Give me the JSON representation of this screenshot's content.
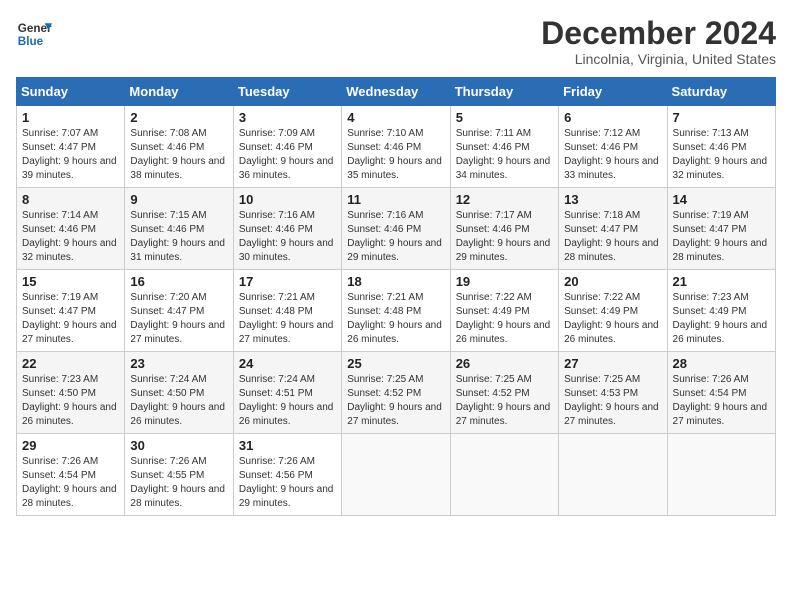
{
  "logo": {
    "line1": "General",
    "line2": "Blue"
  },
  "title": "December 2024",
  "subtitle": "Lincolnia, Virginia, United States",
  "days_of_week": [
    "Sunday",
    "Monday",
    "Tuesday",
    "Wednesday",
    "Thursday",
    "Friday",
    "Saturday"
  ],
  "weeks": [
    [
      {
        "day": "1",
        "sunrise": "Sunrise: 7:07 AM",
        "sunset": "Sunset: 4:47 PM",
        "daylight": "Daylight: 9 hours and 39 minutes."
      },
      {
        "day": "2",
        "sunrise": "Sunrise: 7:08 AM",
        "sunset": "Sunset: 4:46 PM",
        "daylight": "Daylight: 9 hours and 38 minutes."
      },
      {
        "day": "3",
        "sunrise": "Sunrise: 7:09 AM",
        "sunset": "Sunset: 4:46 PM",
        "daylight": "Daylight: 9 hours and 36 minutes."
      },
      {
        "day": "4",
        "sunrise": "Sunrise: 7:10 AM",
        "sunset": "Sunset: 4:46 PM",
        "daylight": "Daylight: 9 hours and 35 minutes."
      },
      {
        "day": "5",
        "sunrise": "Sunrise: 7:11 AM",
        "sunset": "Sunset: 4:46 PM",
        "daylight": "Daylight: 9 hours and 34 minutes."
      },
      {
        "day": "6",
        "sunrise": "Sunrise: 7:12 AM",
        "sunset": "Sunset: 4:46 PM",
        "daylight": "Daylight: 9 hours and 33 minutes."
      },
      {
        "day": "7",
        "sunrise": "Sunrise: 7:13 AM",
        "sunset": "Sunset: 4:46 PM",
        "daylight": "Daylight: 9 hours and 32 minutes."
      }
    ],
    [
      {
        "day": "8",
        "sunrise": "Sunrise: 7:14 AM",
        "sunset": "Sunset: 4:46 PM",
        "daylight": "Daylight: 9 hours and 32 minutes."
      },
      {
        "day": "9",
        "sunrise": "Sunrise: 7:15 AM",
        "sunset": "Sunset: 4:46 PM",
        "daylight": "Daylight: 9 hours and 31 minutes."
      },
      {
        "day": "10",
        "sunrise": "Sunrise: 7:16 AM",
        "sunset": "Sunset: 4:46 PM",
        "daylight": "Daylight: 9 hours and 30 minutes."
      },
      {
        "day": "11",
        "sunrise": "Sunrise: 7:16 AM",
        "sunset": "Sunset: 4:46 PM",
        "daylight": "Daylight: 9 hours and 29 minutes."
      },
      {
        "day": "12",
        "sunrise": "Sunrise: 7:17 AM",
        "sunset": "Sunset: 4:46 PM",
        "daylight": "Daylight: 9 hours and 29 minutes."
      },
      {
        "day": "13",
        "sunrise": "Sunrise: 7:18 AM",
        "sunset": "Sunset: 4:47 PM",
        "daylight": "Daylight: 9 hours and 28 minutes."
      },
      {
        "day": "14",
        "sunrise": "Sunrise: 7:19 AM",
        "sunset": "Sunset: 4:47 PM",
        "daylight": "Daylight: 9 hours and 28 minutes."
      }
    ],
    [
      {
        "day": "15",
        "sunrise": "Sunrise: 7:19 AM",
        "sunset": "Sunset: 4:47 PM",
        "daylight": "Daylight: 9 hours and 27 minutes."
      },
      {
        "day": "16",
        "sunrise": "Sunrise: 7:20 AM",
        "sunset": "Sunset: 4:47 PM",
        "daylight": "Daylight: 9 hours and 27 minutes."
      },
      {
        "day": "17",
        "sunrise": "Sunrise: 7:21 AM",
        "sunset": "Sunset: 4:48 PM",
        "daylight": "Daylight: 9 hours and 27 minutes."
      },
      {
        "day": "18",
        "sunrise": "Sunrise: 7:21 AM",
        "sunset": "Sunset: 4:48 PM",
        "daylight": "Daylight: 9 hours and 26 minutes."
      },
      {
        "day": "19",
        "sunrise": "Sunrise: 7:22 AM",
        "sunset": "Sunset: 4:49 PM",
        "daylight": "Daylight: 9 hours and 26 minutes."
      },
      {
        "day": "20",
        "sunrise": "Sunrise: 7:22 AM",
        "sunset": "Sunset: 4:49 PM",
        "daylight": "Daylight: 9 hours and 26 minutes."
      },
      {
        "day": "21",
        "sunrise": "Sunrise: 7:23 AM",
        "sunset": "Sunset: 4:49 PM",
        "daylight": "Daylight: 9 hours and 26 minutes."
      }
    ],
    [
      {
        "day": "22",
        "sunrise": "Sunrise: 7:23 AM",
        "sunset": "Sunset: 4:50 PM",
        "daylight": "Daylight: 9 hours and 26 minutes."
      },
      {
        "day": "23",
        "sunrise": "Sunrise: 7:24 AM",
        "sunset": "Sunset: 4:50 PM",
        "daylight": "Daylight: 9 hours and 26 minutes."
      },
      {
        "day": "24",
        "sunrise": "Sunrise: 7:24 AM",
        "sunset": "Sunset: 4:51 PM",
        "daylight": "Daylight: 9 hours and 26 minutes."
      },
      {
        "day": "25",
        "sunrise": "Sunrise: 7:25 AM",
        "sunset": "Sunset: 4:52 PM",
        "daylight": "Daylight: 9 hours and 27 minutes."
      },
      {
        "day": "26",
        "sunrise": "Sunrise: 7:25 AM",
        "sunset": "Sunset: 4:52 PM",
        "daylight": "Daylight: 9 hours and 27 minutes."
      },
      {
        "day": "27",
        "sunrise": "Sunrise: 7:25 AM",
        "sunset": "Sunset: 4:53 PM",
        "daylight": "Daylight: 9 hours and 27 minutes."
      },
      {
        "day": "28",
        "sunrise": "Sunrise: 7:26 AM",
        "sunset": "Sunset: 4:54 PM",
        "daylight": "Daylight: 9 hours and 27 minutes."
      }
    ],
    [
      {
        "day": "29",
        "sunrise": "Sunrise: 7:26 AM",
        "sunset": "Sunset: 4:54 PM",
        "daylight": "Daylight: 9 hours and 28 minutes."
      },
      {
        "day": "30",
        "sunrise": "Sunrise: 7:26 AM",
        "sunset": "Sunset: 4:55 PM",
        "daylight": "Daylight: 9 hours and 28 minutes."
      },
      {
        "day": "31",
        "sunrise": "Sunrise: 7:26 AM",
        "sunset": "Sunset: 4:56 PM",
        "daylight": "Daylight: 9 hours and 29 minutes."
      },
      null,
      null,
      null,
      null
    ]
  ]
}
